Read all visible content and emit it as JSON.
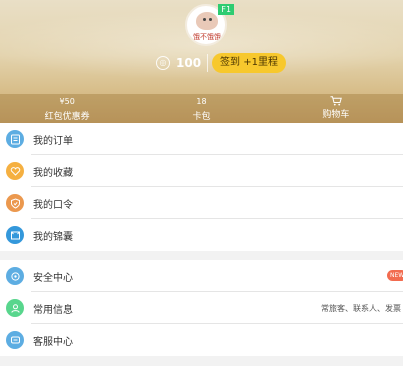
{
  "profile": {
    "avatar_caption": "饿不饿饿",
    "vip_label": "F1",
    "points_value": "100",
    "checkin_label": "签到 +1里程"
  },
  "stats": [
    {
      "num": "¥50",
      "label": "红包优惠券"
    },
    {
      "num": "18",
      "label": "卡包"
    },
    {
      "num": "",
      "label": "购物车",
      "icon": "cart-icon"
    }
  ],
  "menu_group1": [
    {
      "label": "我的订单",
      "icon": "list-icon",
      "color": "#5dade2"
    },
    {
      "label": "我的收藏",
      "icon": "heart-icon",
      "color": "#f5b041"
    },
    {
      "label": "我的口令",
      "icon": "shield-icon",
      "color": "#eb984e"
    },
    {
      "label": "我的锦囊",
      "icon": "scroll-icon",
      "color": "#3498db"
    }
  ],
  "menu_group2": [
    {
      "label": "安全中心",
      "icon": "lock-icon",
      "color": "#5dade2",
      "badge": "NEW"
    },
    {
      "label": "常用信息",
      "icon": "user-icon",
      "color": "#58d68d",
      "info": "常旅客、联系人、发票"
    },
    {
      "label": "客服中心",
      "icon": "chat-icon",
      "color": "#5dade2"
    }
  ]
}
